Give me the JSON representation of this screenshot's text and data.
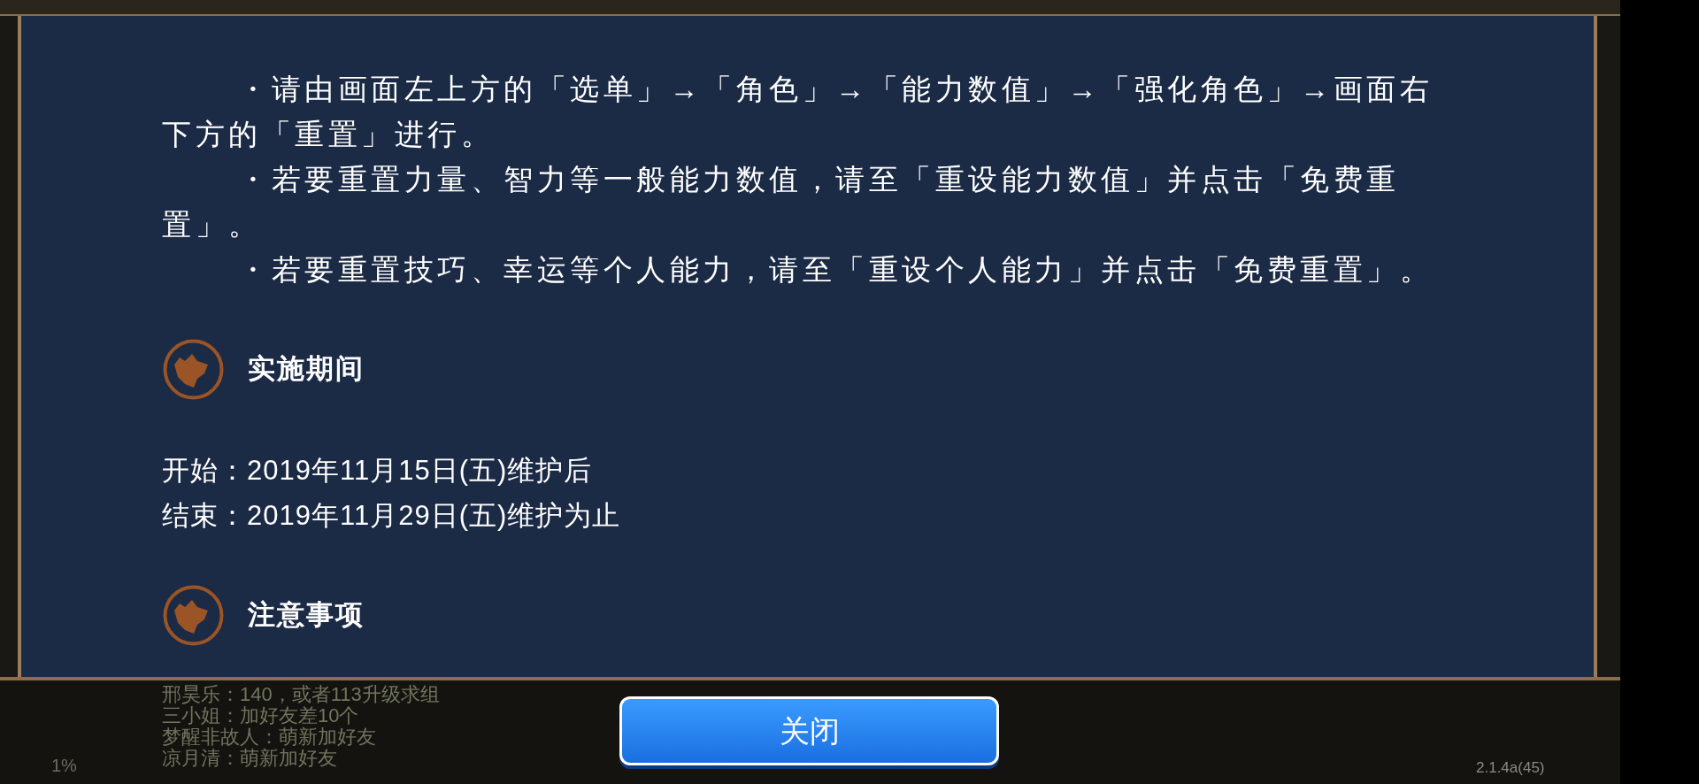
{
  "notice": {
    "paragraphs": [
      "・请由画面左上方的「选单」→「角色」→「能力数值」→「强化角色」→画面右下方的「重置」进行。",
      "・若要重置力量、智力等一般能力数值，请至「重设能力数值」并点击「免费重置」。",
      "・若要重置技巧、幸运等个人能力，请至「重设个人能力」并点击「免费重置」。"
    ],
    "sections": [
      {
        "heading": "实施期间",
        "lines": [
          "开始：2019年11月15日(五)维护后",
          "结束：2019年11月29日(五)维护为止"
        ]
      },
      {
        "heading": "注意事项"
      }
    ]
  },
  "close_button": "关闭",
  "chat": {
    "lines": [
      "邢昊乐：140，或者113升级求组",
      "三小姐：加好友差10个",
      "梦醒非故人：萌新加好友",
      "凉月清：萌新加好友"
    ]
  },
  "progress": "1%",
  "version": "2.1.4a(45)"
}
